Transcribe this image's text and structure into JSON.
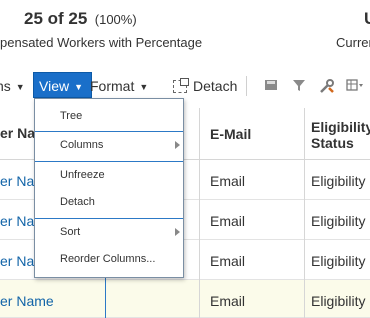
{
  "summary": {
    "count": "25 of 25",
    "percent": "(100%)",
    "description": "pensated Workers with Percentage",
    "right_count": "U",
    "right_description": "Curren"
  },
  "toolbar": {
    "actions_label": "ns",
    "view_label": "View",
    "format_label": "Format",
    "detach_label": "Detach"
  },
  "menu": {
    "items": [
      {
        "label": "Tree"
      },
      {
        "label": "Columns"
      },
      {
        "label": "Unfreeze"
      },
      {
        "label": "Detach"
      },
      {
        "label": "Sort"
      },
      {
        "label": "Reorder Columns..."
      }
    ]
  },
  "table": {
    "headers": {
      "name": "er Nan",
      "email": "E-Mail",
      "eligibility_line1": "Eligibility",
      "eligibility_line2": "Status"
    },
    "rows": [
      {
        "name": "er Nan",
        "email": "Email",
        "eligibility": "Eligibility S"
      },
      {
        "name": "er Nan",
        "email": "Email",
        "eligibility": "Eligibility S"
      },
      {
        "name": "er Nan",
        "email": "Email",
        "eligibility": "Eligibility S"
      },
      {
        "name": "er Name",
        "email": "Email",
        "eligibility": "Eligibility S"
      }
    ]
  },
  "colors": {
    "accent": "#1a6fc9",
    "link": "#1264a8",
    "selected_row": "#fbfbea"
  }
}
